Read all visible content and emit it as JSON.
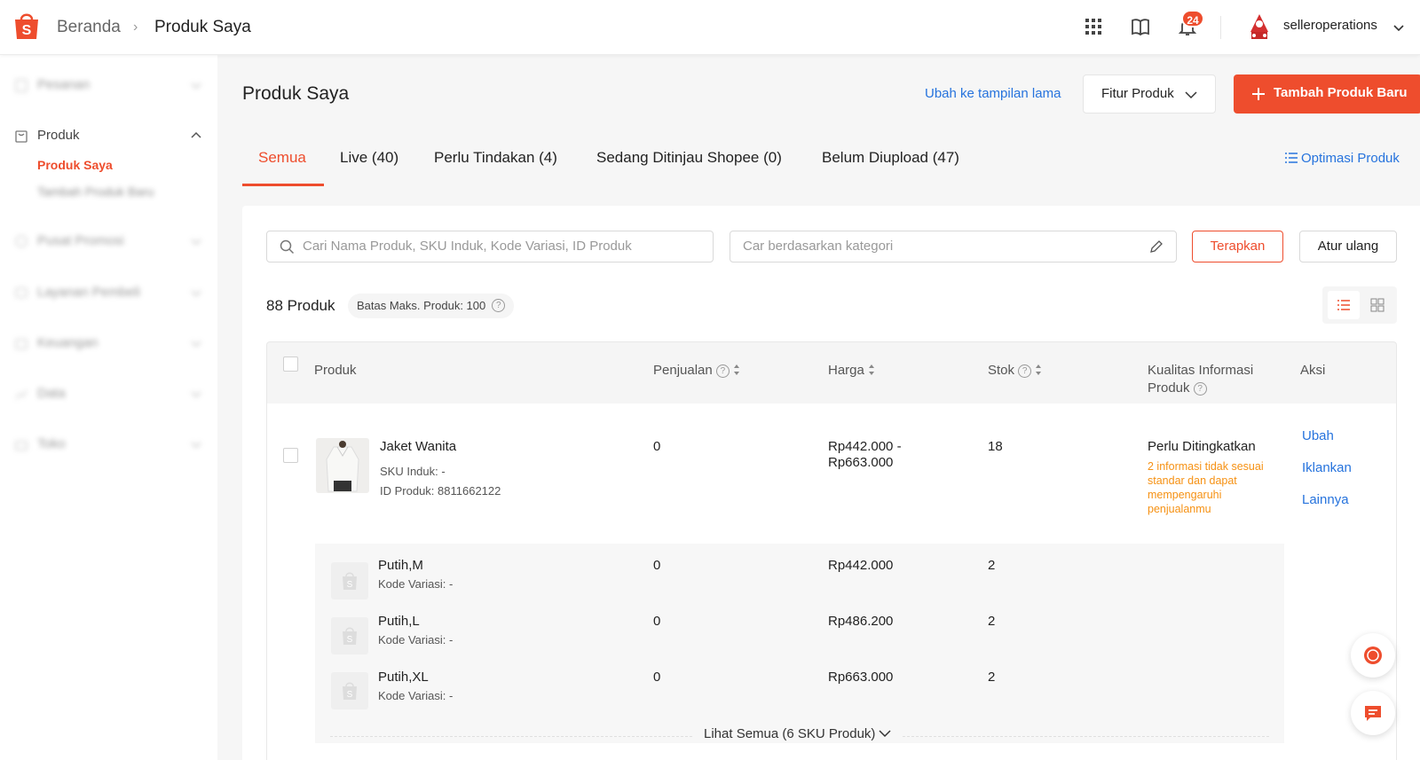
{
  "header": {
    "breadcrumb_home": "Beranda",
    "breadcrumb_current": "Produk Saya",
    "notification_count": "24",
    "username": "selleroperations"
  },
  "sidebar": {
    "items": [
      {
        "label": "Pesanan"
      },
      {
        "label": "Produk"
      },
      {
        "label": "Pusat Promosi"
      },
      {
        "label": "Layanan Pembeli"
      },
      {
        "label": "Keuangan"
      },
      {
        "label": "Data"
      },
      {
        "label": "Toko"
      }
    ],
    "sub_items": [
      {
        "label": "Produk Saya"
      },
      {
        "label": "Tambah Produk Baru"
      }
    ]
  },
  "main": {
    "title": "Produk Saya",
    "old_view_link": "Ubah ke tampilan lama",
    "features_button": "Fitur Produk",
    "add_button": "Tambah Produk Baru",
    "tabs": [
      {
        "label": "Semua"
      },
      {
        "label": "Live (40)"
      },
      {
        "label": "Perlu Tindakan (4)"
      },
      {
        "label": "Sedang Ditinjau Shopee (0)"
      },
      {
        "label": "Belum Diupload (47)"
      }
    ],
    "optimize_link": "Optimasi Produk",
    "search": {
      "placeholder": "Cari Nama Produk, SKU Induk, Kode Variasi, ID Produk"
    },
    "category": {
      "placeholder": "Car berdasarkan kategori"
    },
    "apply_button": "Terapkan",
    "reset_button": "Atur ulang",
    "product_count": "88 Produk",
    "limit_label": "Batas Maks. Produk: 100"
  },
  "table": {
    "headers": {
      "product": "Produk",
      "sales": "Penjualan",
      "price": "Harga",
      "stock": "Stok",
      "quality_1": "Kualitas Informasi",
      "quality_2": "Produk",
      "actions": "Aksi"
    },
    "product": {
      "name": "Jaket Wanita",
      "sku": "SKU Induk: -",
      "id": "ID Produk: 8811662122",
      "sales": "0",
      "price_1": "Rp442.000 -",
      "price_2": "Rp663.000",
      "stock": "18",
      "quality_title": "Perlu Ditingkatkan",
      "quality_desc": "2 informasi tidak sesuai standar dan dapat mempengaruhi penjualanmu",
      "actions": [
        "Ubah",
        "Iklankan",
        "Lainnya"
      ]
    },
    "variations": [
      {
        "name": "Putih,M",
        "code": "Kode Variasi: -",
        "sales": "0",
        "price": "Rp442.000",
        "stock": "2"
      },
      {
        "name": "Putih,L",
        "code": "Kode Variasi: -",
        "sales": "0",
        "price": "Rp486.200",
        "stock": "2"
      },
      {
        "name": "Putih,XL",
        "code": "Kode Variasi: -",
        "sales": "0",
        "price": "Rp663.000",
        "stock": "2"
      }
    ],
    "see_all": "Lihat Semua (6 SKU Produk)"
  },
  "colors": {
    "accent": "#ee4d2d",
    "link": "#2673dd",
    "warning": "#f69113"
  }
}
